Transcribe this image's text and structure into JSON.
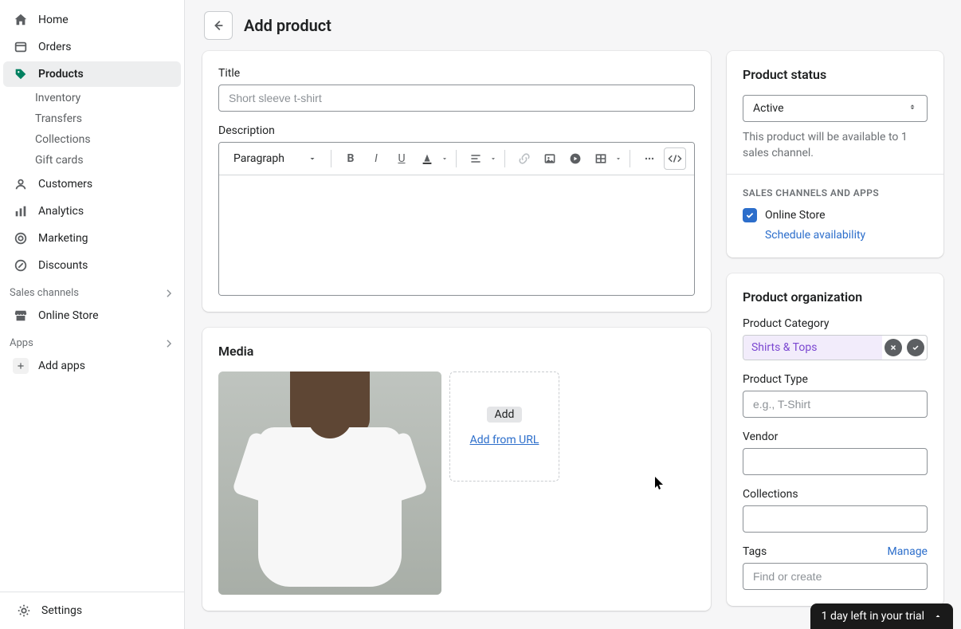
{
  "nav": {
    "home": "Home",
    "orders": "Orders",
    "products": "Products",
    "inventory": "Inventory",
    "transfers": "Transfers",
    "collections": "Collections",
    "gift_cards": "Gift cards",
    "customers": "Customers",
    "analytics": "Analytics",
    "marketing": "Marketing",
    "discounts": "Discounts",
    "sales_channels_label": "Sales channels",
    "online_store": "Online Store",
    "apps_label": "Apps",
    "add_apps": "Add apps",
    "settings": "Settings"
  },
  "page": {
    "title": "Add product"
  },
  "form": {
    "title_label": "Title",
    "title_placeholder": "Short sleeve t-shirt",
    "description_label": "Description",
    "paragraph_label": "Paragraph"
  },
  "media": {
    "heading": "Media",
    "add_label": "Add",
    "add_url_label": "Add from URL"
  },
  "status": {
    "heading": "Product status",
    "value": "Active",
    "help": "This product will be available to 1 sales channel.",
    "channels_heading": "SALES CHANNELS AND APPS",
    "online_store": "Online Store",
    "schedule": "Schedule availability"
  },
  "org": {
    "heading": "Product organization",
    "category_label": "Product Category",
    "category_value": "Shirts & Tops",
    "type_label": "Product Type",
    "type_placeholder": "e.g., T-Shirt",
    "vendor_label": "Vendor",
    "collections_label": "Collections",
    "tags_label": "Tags",
    "manage": "Manage",
    "tags_placeholder": "Find or create"
  },
  "trial": {
    "text": "1 day left in your trial"
  }
}
